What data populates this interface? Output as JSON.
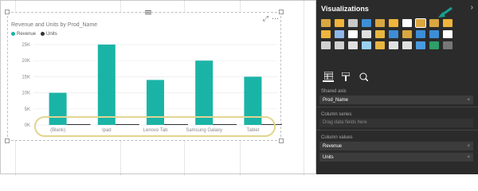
{
  "canvas": {
    "vis_tools": [
      "⤢",
      "⋯"
    ]
  },
  "chart_data": {
    "type": "bar",
    "title": "Revenue and Units by Prod_Name",
    "categories": [
      "(Blank)",
      "Ipad",
      "Lenovo Tab",
      "Samsung Galaxy",
      "Tablet"
    ],
    "series": [
      {
        "name": "Revenue",
        "values": [
          10000,
          25000,
          14000,
          20000,
          15000
        ],
        "color": "#1ab4a7"
      },
      {
        "name": "Units",
        "values": [
          0,
          0,
          0,
          0,
          0
        ],
        "color": "#333333"
      }
    ],
    "ylim": [
      0,
      25000
    ],
    "yticks": [
      "0K",
      "5K",
      "10K",
      "15K",
      "20K",
      "25K"
    ],
    "grid": true,
    "legend_position": "top-left"
  },
  "panel": {
    "title": "Visualizations",
    "collapse": "›",
    "fields_shared_axis_label": "Shared axis",
    "shared_axis_value": "Prod_Name",
    "column_series_label": "Column series",
    "column_series_placeholder": "Drag data fields here",
    "column_values_label": "Column values",
    "column_values": [
      "Revenue",
      "Units"
    ],
    "remove_icon": "×",
    "highlight_color": "#ffffff",
    "accent_arrow_color": "#1a9e92"
  },
  "viz_icons": [
    "stacked-bar-icon",
    "stacked-column-icon",
    "clustered-bar-icon",
    "clustered-column-icon",
    "100-bar-icon",
    "100-column-icon",
    "line-icon",
    "area-icon",
    "stacked-area-icon",
    "line-column-icon",
    "line-clustered-column-icon",
    "ribbon-icon",
    "waterfall-icon",
    "scatter-icon",
    "pie-icon",
    "donut-icon",
    "treemap-icon",
    "map-icon",
    "filled-map-icon",
    "funnel-icon",
    "gauge-icon",
    "card-icon",
    "multirow-card-icon",
    "kpi-icon",
    "slicer-icon",
    "table-icon",
    "matrix-icon",
    "r-visual-icon",
    "globe-icon",
    "more-icon"
  ],
  "viz_icon_colors": [
    "#d9a640",
    "#f0b43c",
    "#c8c8c8",
    "#3d8ed6",
    "#d9a640",
    "#f0b43c",
    "#ffffff",
    "#d9a640",
    "#d9a640",
    "#f0b43c",
    "#f0b43c",
    "#8fb8e8",
    "#ffffff",
    "#e0e0e0",
    "#e8b640",
    "#3d8ed6",
    "#d9a640",
    "#3d8ed6",
    "#3d8ed6",
    "#ffffff",
    "#d0d0d0",
    "#d0d0d0",
    "#e0e0e0",
    "#9ad0f0",
    "#e8b640",
    "#e0e0e0",
    "#e0e0e0",
    "#4a9be0",
    "#2f9e6a",
    "#777777"
  ],
  "tabs": [
    "fields-tab-icon",
    "format-tab-icon",
    "analytics-tab-icon"
  ]
}
